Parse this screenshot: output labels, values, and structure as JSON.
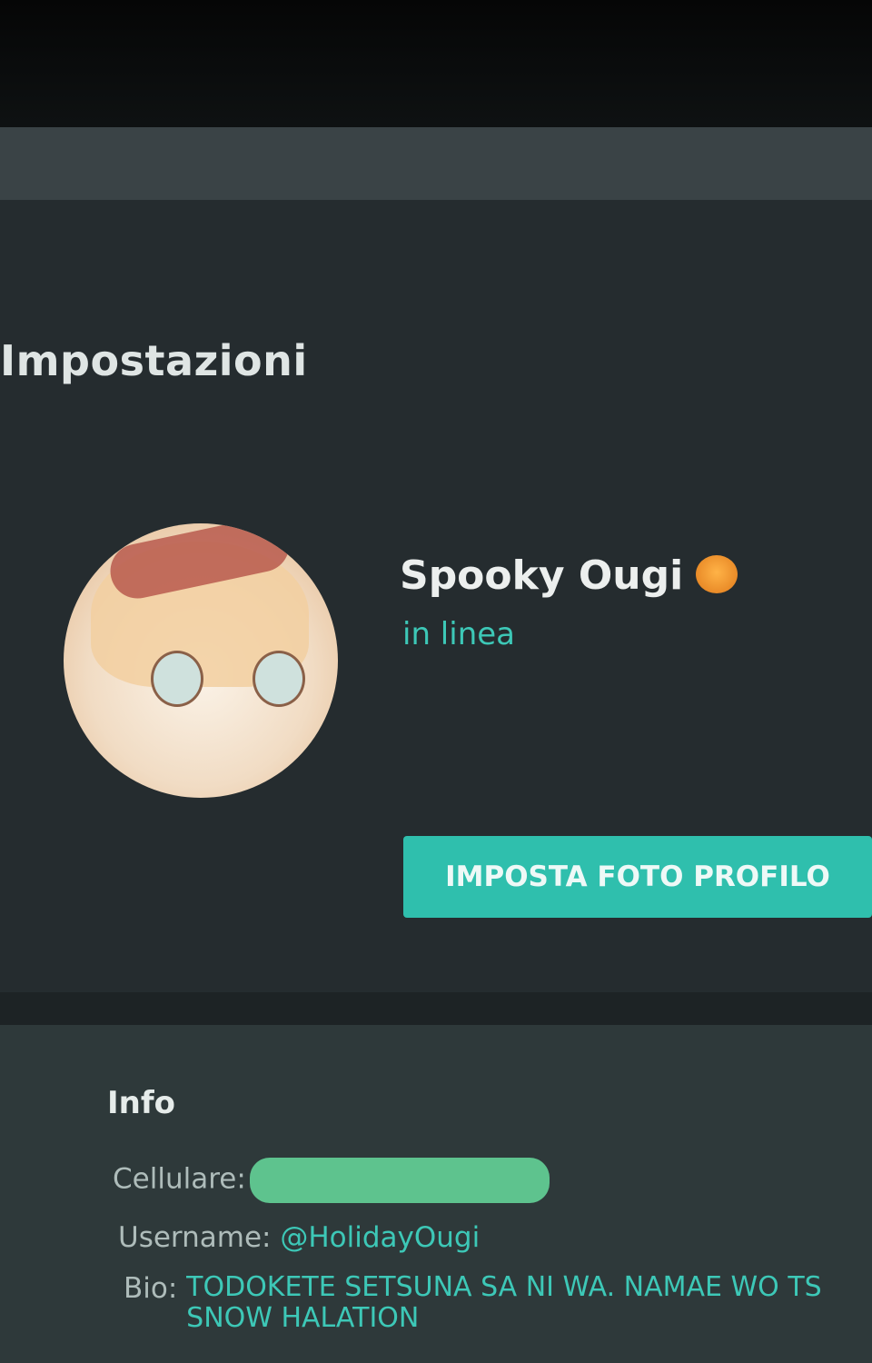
{
  "settings": {
    "title": "Impostazioni"
  },
  "profile": {
    "name": "Spooky Ougi",
    "name_emoji_icon": "pumpkin-icon",
    "status": "in linea",
    "set_photo_label": "IMPOSTA FOTO PROFILO",
    "status_color": "#3dc8b7",
    "accent_color": "#2fbfad"
  },
  "info": {
    "title": "Info",
    "phone_label": "Cellulare:",
    "username_label": "Username:",
    "username_value": "@HolidayOugi",
    "bio_label": "Bio:",
    "bio_line1": "TODOKETE SETSUNA SA NI WA. NAMAE WO TS",
    "bio_line2": "SNOW HALATION"
  }
}
